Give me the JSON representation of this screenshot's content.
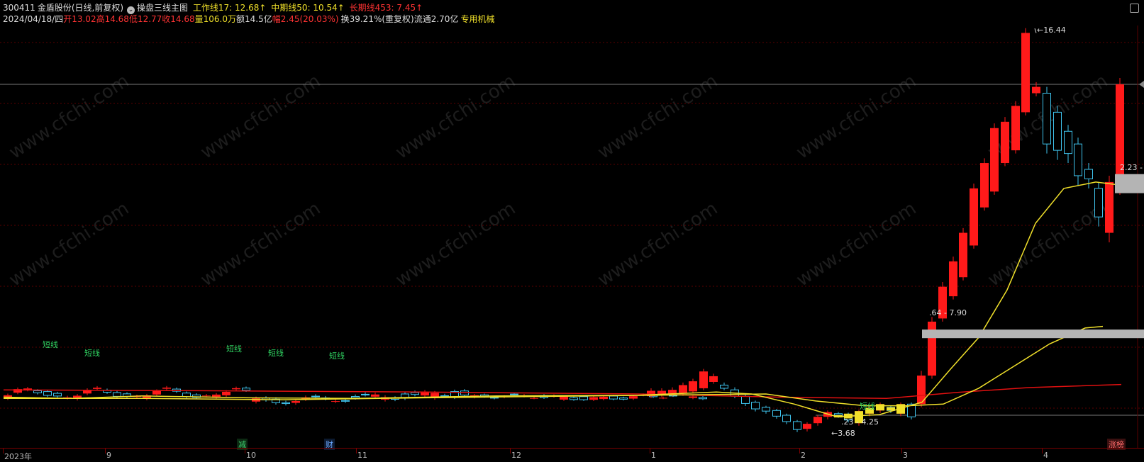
{
  "header": {
    "code": "300411",
    "name": "金盾股份",
    "period": "(日线,前复权)",
    "indicator_name": "操盘三线主图",
    "work_line": "工作线17: 12.68↑",
    "mid_line": "中期线50: 10.54↑",
    "long_line": "长期线453: 7.45↑"
  },
  "quote": {
    "date": "2024/04/18/四",
    "open": "开13.02",
    "high": "高14.68",
    "low": "低12.77",
    "close": "收14.68",
    "volume": "量106.0万",
    "amount": "额14.5亿",
    "change": "幅2.45(20.03%)",
    "turnover": "换39.21%(重复权)",
    "float_cap": "流通2.70亿",
    "sector": "专用机械"
  },
  "price_marks": {
    "high_mark": "16.44",
    "low_mark": "3.68",
    "zone_low": ".23 - 4.25",
    "zone_mid": ".64 - 7.90",
    "zone_high": "2.23 -"
  },
  "short_line_label": "短线",
  "date_axis": {
    "labels": [
      "2023年",
      "9",
      "10",
      "11",
      "12",
      "1",
      "2",
      "3",
      "4"
    ]
  },
  "events": {
    "reduce": "减",
    "finance": "财",
    "limit_board": "涨榜"
  },
  "watermark": "www.cfchi.com",
  "colors": {
    "up": "#ff1a1a",
    "down": "#3fc4ee",
    "ma_yellow": "#f0e02a",
    "long_red": "#e01010",
    "zone_gray": "#b4b4b4"
  },
  "chart_data": {
    "type": "candlestick",
    "ylim": [
      3.2,
      17.4
    ],
    "lines": [
      {
        "name": "长期线453",
        "color": "#e01010"
      },
      {
        "name": "工作线17",
        "color": "#f0e02a"
      },
      {
        "name": "中期线50",
        "color": "#f0e02a"
      }
    ]
  }
}
